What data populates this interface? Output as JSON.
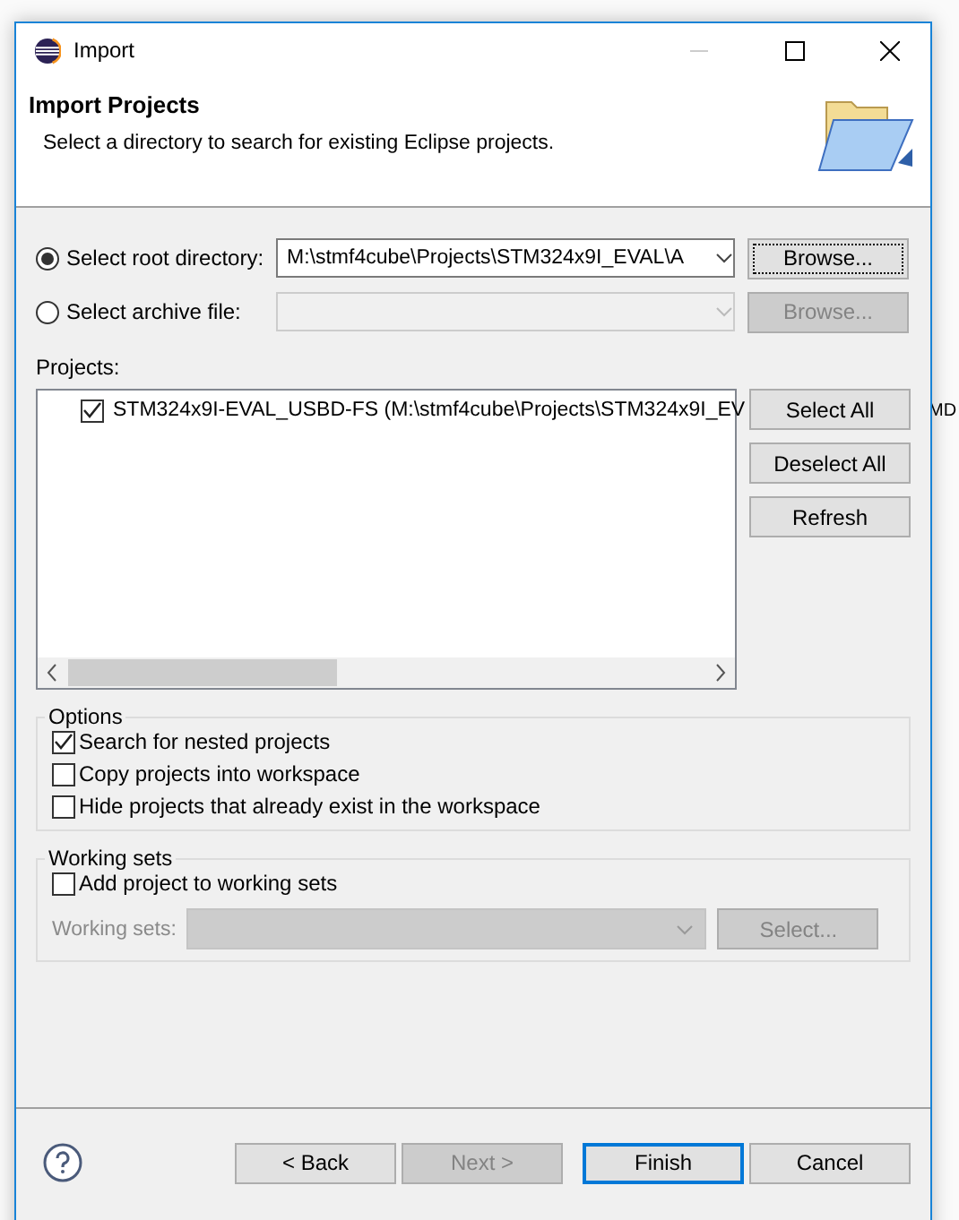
{
  "window": {
    "title": "Import"
  },
  "background_text": "MD",
  "header": {
    "title": "Import Projects",
    "description": "Select a directory to search for existing Eclipse projects."
  },
  "sources": [
    {
      "label": "Select root directory:",
      "selected": true,
      "value": "M:\\stmf4cube\\Projects\\STM324x9I_EVAL\\A",
      "button": "Browse..."
    },
    {
      "label": "Select archive file:",
      "selected": false,
      "button": "Browse..."
    }
  ],
  "projects": {
    "label": "Projects:",
    "items": [
      {
        "label": "STM324x9I-EVAL_USBD-FS (M:\\stmf4cube\\Projects\\STM324x9I_EV",
        "checked": true
      }
    ],
    "buttons": [
      "Select All",
      "Deselect All",
      "Refresh"
    ]
  },
  "options": {
    "title": "Options",
    "items": [
      {
        "label": "Search for nested projects",
        "checked": true
      },
      {
        "label": "Copy projects into workspace",
        "checked": false
      },
      {
        "label": "Hide projects that already exist in the workspace",
        "checked": false
      }
    ]
  },
  "working_sets": {
    "title": "Working sets",
    "checkbox": {
      "label": "Add project to working sets",
      "checked": false
    },
    "field_label": "Working sets:",
    "button": "Select..."
  },
  "footer": {
    "buttons": [
      {
        "label": "< Back",
        "disabled": false,
        "default": false
      },
      {
        "label": "Next >",
        "disabled": true,
        "default": false
      },
      {
        "label": "Finish",
        "disabled": false,
        "default": true
      },
      {
        "label": "Cancel",
        "disabled": false,
        "default": false
      }
    ]
  }
}
